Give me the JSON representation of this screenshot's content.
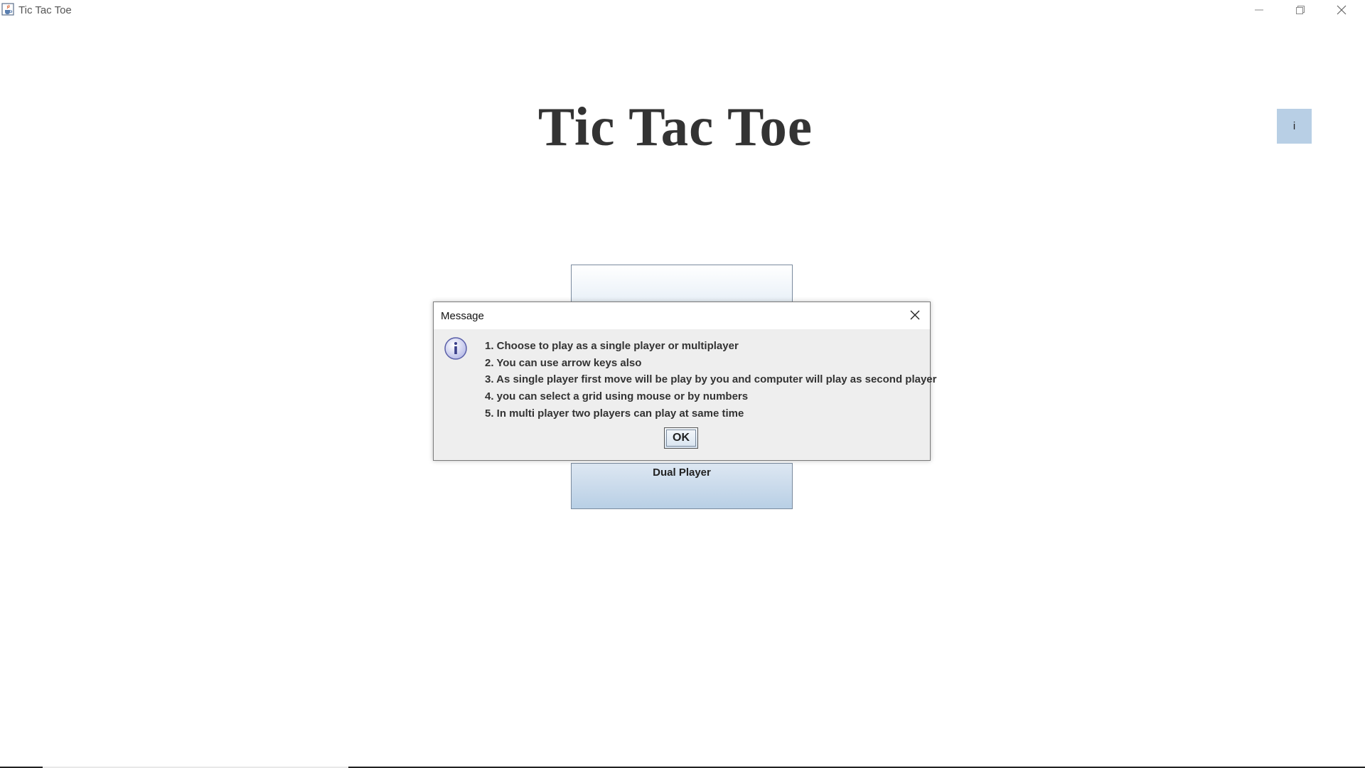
{
  "window": {
    "title": "Tic Tac Toe",
    "icons": {
      "app": "java-cup-icon",
      "minimize": "minimize-icon",
      "maximize": "restore-icon",
      "close": "close-icon"
    }
  },
  "main": {
    "title": "Tic Tac Toe",
    "info_button_label": "i",
    "mode_buttons": {
      "top_label": "",
      "bottom_label": "Dual Player"
    }
  },
  "dialog": {
    "title": "Message",
    "icon": "info-icon",
    "messages": [
      "1. Choose to play as a single player or multiplayer",
      "2. You can use arrow keys also",
      "3. As single player first move will be play by you and computer will play as second player",
      "4. you can select a grid using mouse or by numbers",
      "5. In multi player two players can play at same time"
    ],
    "ok_label": "OK"
  },
  "colors": {
    "button_blue": "#b8cfe5",
    "title_text": "#333333",
    "dialog_bg": "#eeeeee"
  }
}
